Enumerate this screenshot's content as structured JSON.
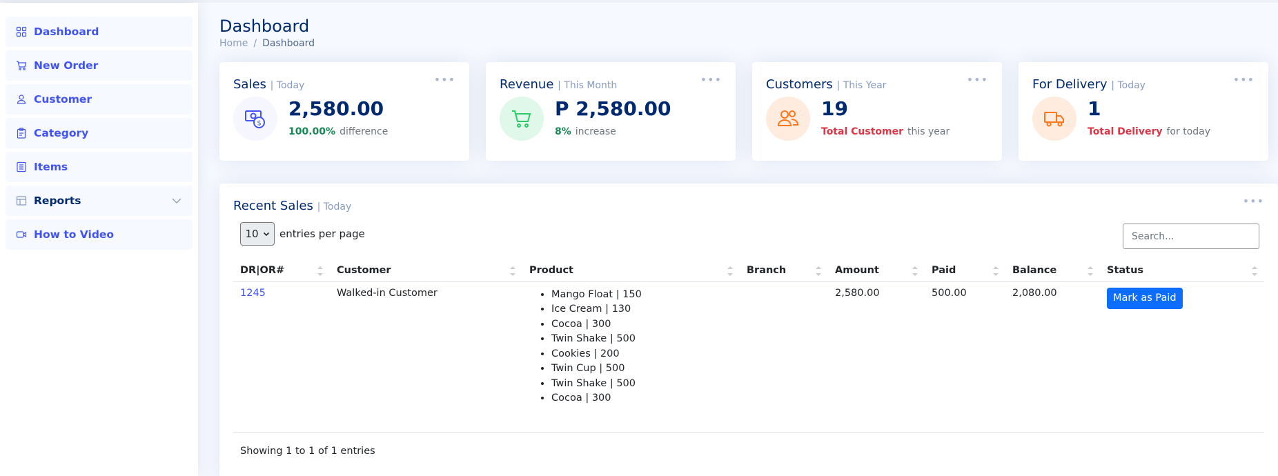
{
  "sidebar": {
    "items": [
      {
        "label": "Dashboard",
        "icon": "grid-icon"
      },
      {
        "label": "New Order",
        "icon": "cart-icon"
      },
      {
        "label": "Customer",
        "icon": "person-icon"
      },
      {
        "label": "Category",
        "icon": "clipboard-icon"
      },
      {
        "label": "Items",
        "icon": "list-icon"
      },
      {
        "label": "Reports",
        "icon": "layout-icon"
      },
      {
        "label": "How to Video",
        "icon": "camera-video-icon"
      }
    ]
  },
  "page": {
    "title": "Dashboard",
    "breadcrumb": {
      "home": "Home",
      "sep": "/",
      "current": "Dashboard"
    }
  },
  "cards": {
    "sales": {
      "title": "Sales",
      "period": "| Today",
      "value": "2,580.00",
      "pct": "100.00%",
      "note": "difference",
      "pct_color": "#198754",
      "icon": "cash-coin-icon"
    },
    "revenue": {
      "title": "Revenue",
      "period": "| This Month",
      "value": "P 2,580.00",
      "pct": "8%",
      "note": "increase",
      "pct_color": "#198754",
      "icon": "cart-icon"
    },
    "customers": {
      "title": "Customers",
      "period": "| This Year",
      "value": "19",
      "highlight": "Total Customer",
      "note": "this year",
      "highlight_color": "#dc3545",
      "icon": "people-icon"
    },
    "delivery": {
      "title": "For Delivery",
      "period": "| Today",
      "value": "1",
      "highlight": "Total Delivery",
      "note": "for today",
      "highlight_color": "#dc3545",
      "icon": "truck-icon"
    }
  },
  "recent_sales": {
    "title": "Recent Sales",
    "period": "| Today",
    "entries_value": "10",
    "entries_label": "entries per page",
    "search_placeholder": "Search...",
    "columns": [
      "DR|OR#",
      "Customer",
      "Product",
      "Branch",
      "Amount",
      "Paid",
      "Balance",
      "Status"
    ],
    "rows": [
      {
        "dr_or": "1245",
        "customer": "Walked-in Customer",
        "products": [
          "Mango Float | 150",
          "Ice Cream | 130",
          "Cocoa | 300",
          "Twin Shake | 500",
          "Cookies | 200",
          "Twin Cup | 500",
          "Twin Shake | 500",
          "Cocoa | 300"
        ],
        "branch": "",
        "amount": "2,580.00",
        "paid": "500.00",
        "balance": "2,080.00",
        "status_button": "Mark as Paid"
      }
    ],
    "info": "Showing 1 to 1 of 1 entries"
  },
  "colors": {
    "accent": "#4154f1",
    "navy": "#012970",
    "primary_button": "#0d6efd"
  }
}
